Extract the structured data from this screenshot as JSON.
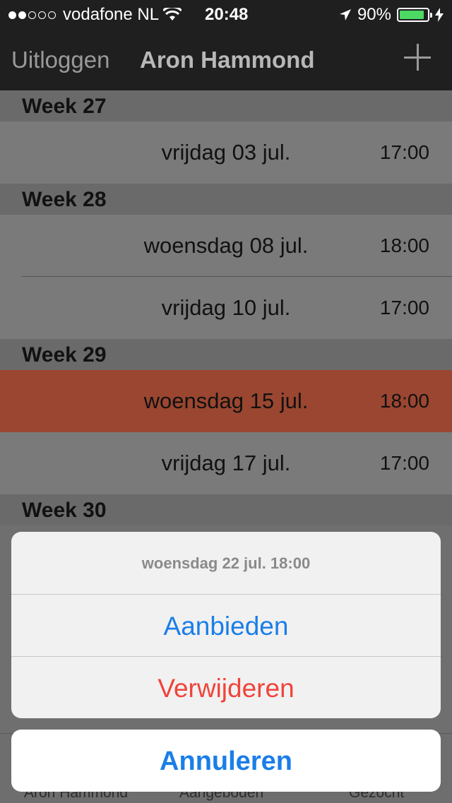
{
  "status": {
    "carrier": "vodafone NL",
    "time": "20:48",
    "battery": "90%",
    "signal_dots_filled": 2,
    "signal_dots_total": 5,
    "battery_level": 0.9
  },
  "nav": {
    "logout": "Uitloggen",
    "title": "Aron Hammond",
    "add_icon": "plus-icon"
  },
  "sections": [
    {
      "header": "Week 27",
      "rows": [
        {
          "date": "vrijdag 03 jul.",
          "time": "17:00"
        }
      ]
    },
    {
      "header": "Week 28",
      "rows": [
        {
          "date": "woensdag 08 jul.",
          "time": "18:00"
        },
        {
          "date": "vrijdag 10 jul.",
          "time": "17:00"
        }
      ]
    },
    {
      "header": "Week 29",
      "rows": [
        {
          "date": "woensdag 15 jul.",
          "time": "18:00",
          "selected": true
        },
        {
          "date": "vrijdag 17 jul.",
          "time": "17:00"
        }
      ]
    },
    {
      "header": "Week 30",
      "rows": []
    }
  ],
  "tabs": [
    "Aron Hammond",
    "Aangeboden",
    "Gezocht"
  ],
  "action_sheet": {
    "title": "woensdag 22 jul. 18:00",
    "offer": "Aanbieden",
    "delete": "Verwijderen",
    "cancel": "Annuleren"
  },
  "colors": {
    "selected_row": "#9a4630",
    "action_blue": "#1a7ee8",
    "destructive_red": "#f0443a",
    "battery_green": "#4cd964"
  }
}
